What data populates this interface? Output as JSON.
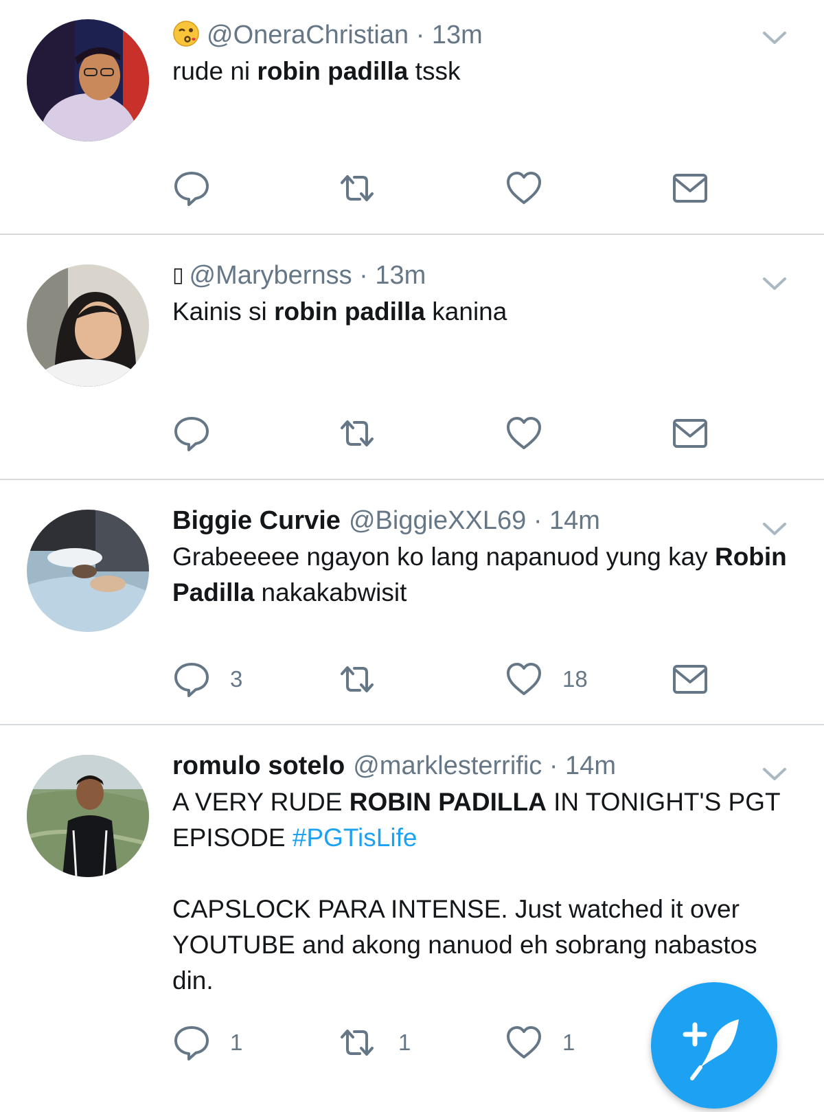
{
  "tweets": [
    {
      "handle": "@OneraChristian",
      "time": "· 13m",
      "text": {
        "pre": "rude ni ",
        "bold": "robin padilla",
        "post": " tssk"
      }
    },
    {
      "glyph": "▯",
      "handle": "@Marybernss",
      "time": "· 13m",
      "text": {
        "pre": "Kainis si ",
        "bold": "robin padilla",
        "post": " kanina"
      }
    },
    {
      "name": "Biggie Curvie",
      "handle": "@BiggieXXL69",
      "time": "· 14m",
      "text": {
        "pre": "Grabeeeee ngayon ko lang napanuod yung kay ",
        "bold": "Robin Padilla",
        "post": " nakakabwisit"
      },
      "reply_count": "3",
      "like_count": "18"
    },
    {
      "name": "romulo sotelo",
      "handle": "@marklesterrific",
      "time": "· 14m",
      "text": {
        "pre": "A VERY RUDE ",
        "bold": "ROBIN PADILLA",
        "post": " IN TONIGHT'S PGT EPISODE ",
        "hashtag": "#PGTisLife",
        "para2": "CAPSLOCK PARA INTENSE. Just watched it over YOUTUBE and akong nanuod eh sobrang nabastos din."
      },
      "reply_count": "1",
      "retweet_count": "1",
      "like_count": "1"
    }
  ],
  "icons": {
    "reply": "reply-icon",
    "retweet": "retweet-icon",
    "like": "heart-icon",
    "dm": "envelope-icon",
    "more": "chevron-down-icon",
    "compose": "compose-tweet-icon"
  },
  "colors": {
    "accent": "#1da1f2",
    "muted": "#657786",
    "text": "#14171a"
  }
}
